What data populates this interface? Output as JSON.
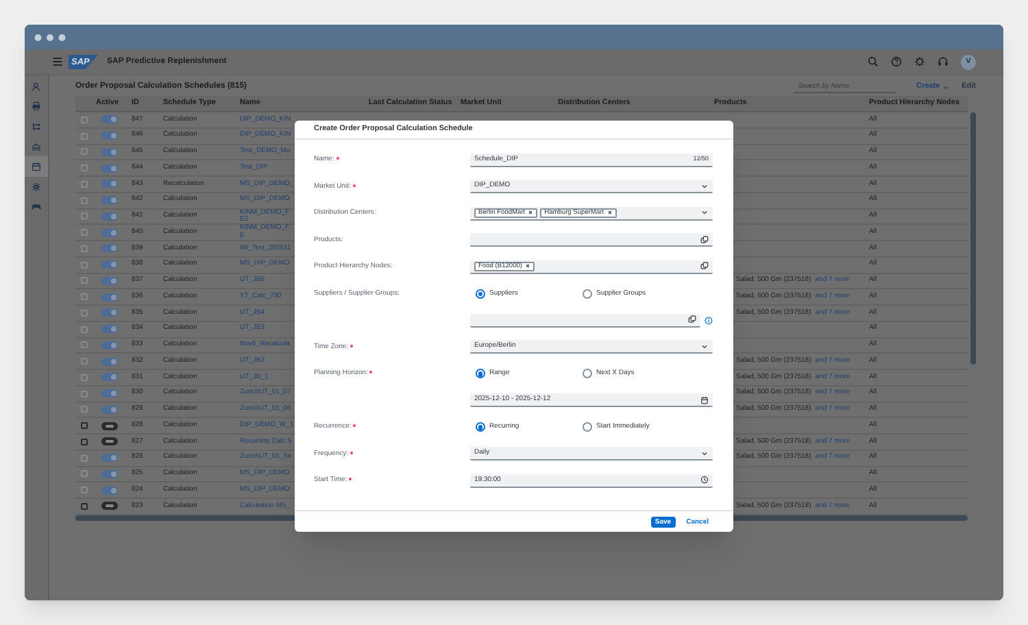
{
  "app_bar": {
    "logo": "SAP",
    "title": "SAP Predictive Replenishment",
    "actions": [
      {
        "kind": "search"
      },
      {
        "kind": "help"
      },
      {
        "kind": "settings"
      },
      {
        "kind": "headset"
      }
    ],
    "avatar": "V"
  },
  "sidebar": {
    "items": [
      {
        "kind": "person",
        "selected": false
      },
      {
        "kind": "printer",
        "selected": false
      },
      {
        "kind": "hierarchy",
        "selected": false
      },
      {
        "kind": "stack",
        "selected": false
      },
      {
        "kind": "calendar",
        "selected": true
      },
      {
        "kind": "gear",
        "selected": false
      },
      {
        "kind": "gamepad",
        "selected": false
      }
    ]
  },
  "table": {
    "title": "Order Proposal Calculation Schedules (815)",
    "search": {
      "placeholder": "Search by Name"
    },
    "actions": [
      {
        "label": "Create",
        "disabled": false,
        "menu": true
      },
      {
        "label": "Edit",
        "disabled": true,
        "menu": false
      }
    ],
    "columns": [
      "Active",
      "ID",
      "Schedule Type",
      "Name",
      "Last Calculation Status",
      "Market Unit",
      "Distribution Centers",
      "Products",
      "Product Hierarchy Nodes"
    ],
    "rows": [
      {
        "selected": false,
        "active": true,
        "id": "847",
        "schedule_type": "Calculation",
        "name": "DIP_DEMO_KIN",
        "hierarchy": "All"
      },
      {
        "selected": false,
        "active": true,
        "id": "846",
        "schedule_type": "Calculation",
        "name": "DIP_DEMO_KIN",
        "hierarchy": "All"
      },
      {
        "selected": false,
        "active": true,
        "id": "845",
        "schedule_type": "Calculation",
        "name": "Test_DEMO_Mo",
        "hierarchy": "All"
      },
      {
        "selected": false,
        "active": true,
        "id": "844",
        "schedule_type": "Calculation",
        "name": "Test_DIP",
        "hierarchy": "All"
      },
      {
        "selected": false,
        "active": true,
        "id": "843",
        "schedule_type": "Recalculation",
        "name": "MS_DIP_DEMO_",
        "hierarchy": "All"
      },
      {
        "selected": false,
        "active": true,
        "id": "842",
        "schedule_type": "Calculation",
        "name": "MS_DIP_DEMO",
        "hierarchy": "All"
      },
      {
        "selected": false,
        "active": true,
        "id": "841",
        "schedule_type": "Calculation",
        "name": "KINM_DEMO_F\nE2",
        "hierarchy": "All"
      },
      {
        "selected": false,
        "active": true,
        "id": "840",
        "schedule_type": "Calculation",
        "name": "KINM_DEMO_F\nE",
        "hierarchy": "All"
      },
      {
        "selected": false,
        "active": true,
        "id": "839",
        "schedule_type": "Calculation",
        "name": "IW_Test_202511",
        "hierarchy": "All"
      },
      {
        "selected": false,
        "active": true,
        "id": "838",
        "schedule_type": "Calculation",
        "name": "MS_DIP_DEMO",
        "hierarchy": "All"
      },
      {
        "selected": false,
        "active": true,
        "id": "837",
        "schedule_type": "Calculation",
        "name": "UT_JB5",
        "products": "Salad, 500 Gm (237518)",
        "products_more": "and 7 more",
        "hierarchy": "All"
      },
      {
        "selected": false,
        "active": true,
        "id": "836",
        "schedule_type": "Calculation",
        "name": "YT_Calc_730",
        "products": "Salad, 500 Gm (237518)",
        "products_more": "and 7 more",
        "hierarchy": "All"
      },
      {
        "selected": false,
        "active": true,
        "id": "835",
        "schedule_type": "Calculation",
        "name": "UT_JB4",
        "products": "Salad, 500 Gm (237518)",
        "products_more": "and 7 more",
        "hierarchy": "All"
      },
      {
        "selected": false,
        "active": true,
        "id": "834",
        "schedule_type": "Calculation",
        "name": "UT_JB3",
        "hierarchy": "All"
      },
      {
        "selected": false,
        "active": true,
        "id": "833",
        "schedule_type": "Calculation",
        "name": "Nov6_Recalcula",
        "hierarchy": "All"
      },
      {
        "selected": false,
        "active": true,
        "id": "832",
        "schedule_type": "Calculation",
        "name": "UT_JB2",
        "products": "Salad, 500 Gm (237518)",
        "products_more": "and 7 more",
        "hierarchy": "All"
      },
      {
        "selected": false,
        "active": true,
        "id": "831",
        "schedule_type": "Calculation",
        "name": "UT_JB_1",
        "products": "Salad, 500 Gm (237518)",
        "products_more": "and 7 more",
        "hierarchy": "All"
      },
      {
        "selected": false,
        "active": true,
        "id": "830",
        "schedule_type": "Calculation",
        "name": "ZurichUT_01_07",
        "products": "Salad, 500 Gm (237518)",
        "products_more": "and 7 more",
        "hierarchy": "All"
      },
      {
        "selected": false,
        "active": true,
        "id": "829",
        "schedule_type": "Calculation",
        "name": "ZurichUT_01_06",
        "products": "Salad, 500 Gm (237518)",
        "products_more": "and 7 more",
        "hierarchy": "All"
      },
      {
        "selected": false,
        "active": false,
        "id": "828",
        "schedule_type": "Calculation",
        "name": "DIP_DEMO_W_1",
        "hierarchy": "All"
      },
      {
        "selected": false,
        "active": false,
        "id": "827",
        "schedule_type": "Calculation",
        "name": "Recurring Calc S",
        "products": "Salad, 500 Gm (237518)",
        "products_more": "and 7 more",
        "hierarchy": "All"
      },
      {
        "selected": false,
        "active": true,
        "id": "826",
        "schedule_type": "Calculation",
        "name": "ZurichUT_01_Se",
        "products": "Salad, 500 Gm (237518)",
        "products_more": "and 7 more",
        "hierarchy": "All"
      },
      {
        "selected": false,
        "active": true,
        "id": "825",
        "schedule_type": "Calculation",
        "name": "MS_DIP_DEMO",
        "hierarchy": "All"
      },
      {
        "selected": false,
        "active": true,
        "id": "824",
        "schedule_type": "Calculation",
        "name": "MS_DIP_DEMO",
        "hierarchy": "All"
      },
      {
        "selected": false,
        "active": false,
        "id": "823",
        "schedule_type": "Calculation",
        "name": "Calculation MS_",
        "products": "Salad, 500 Gm (237518)",
        "products_more": "and 7 more",
        "hierarchy": "All"
      }
    ]
  },
  "dialog": {
    "title": "Create Order Proposal Calculation Schedule",
    "fields": [
      {
        "kind": "input",
        "label": "Name:",
        "required": true,
        "value": "Schedule_DIP",
        "counter": "12/50"
      },
      {
        "kind": "select",
        "label": "Market Unit:",
        "required": true,
        "value": "DIP_DEMO"
      },
      {
        "kind": "multiselect",
        "label": "Distribution Centers:",
        "tokens": [
          "Berlin FoodMart",
          "Hamburg SuperMart"
        ]
      },
      {
        "kind": "valuehelp",
        "label": "Products:"
      },
      {
        "kind": "valuehelp",
        "label": "Product Hierarchy Nodes:",
        "tokens": [
          "Food (B12000)"
        ]
      },
      {
        "kind": "radio",
        "label": "Suppliers / Supplier Groups:",
        "options": [
          {
            "label": "Suppliers",
            "selected": true
          },
          {
            "label": "Supplier Groups",
            "selected": false
          }
        ]
      },
      {
        "kind": "valuehelp",
        "info": true
      },
      {
        "kind": "select",
        "label": "Time Zone:",
        "required": true,
        "value": "Europe/Berlin"
      },
      {
        "kind": "radio",
        "label": "Planning Horizon:",
        "required": true,
        "options": [
          {
            "label": "Range",
            "selected": true
          },
          {
            "label": "Next X Days",
            "selected": false
          }
        ]
      },
      {
        "kind": "date",
        "value": "2025-12-10 - 2025-12-12"
      },
      {
        "kind": "radio",
        "label": "Recurrence:",
        "required": true,
        "options": [
          {
            "label": "Recurring",
            "selected": true
          },
          {
            "label": "Start Immediately",
            "selected": false
          }
        ]
      },
      {
        "kind": "select",
        "label": "Frequency:",
        "required": true,
        "value": "Daily"
      },
      {
        "kind": "time",
        "label": "Start Time:",
        "required": true,
        "value": "19:30:00"
      }
    ],
    "buttons": [
      {
        "label": "Save",
        "kind": "primary"
      },
      {
        "label": "Cancel",
        "kind": "transparent"
      }
    ]
  }
}
